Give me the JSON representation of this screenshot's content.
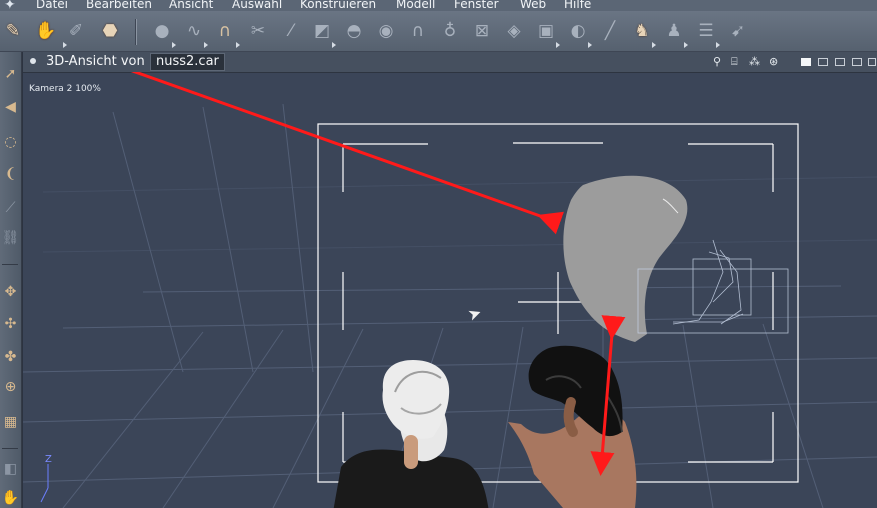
{
  "app": {
    "menu": [
      "Datei",
      "Bearbeiten",
      "Ansicht",
      "Auswahl",
      "Konstruieren",
      "Modell",
      "Fenster",
      "Web",
      "Hilfe"
    ]
  },
  "toolbar": {
    "tools": [
      {
        "icon": "brush-tool-icon"
      },
      {
        "icon": "hand-tool-icon"
      },
      {
        "icon": "bone-tool-icon"
      },
      {
        "icon": "paint-bucket-icon"
      },
      {
        "icon": "sphere-icon"
      },
      {
        "icon": "spline-icon"
      },
      {
        "icon": "magnet-icon"
      },
      {
        "icon": "scissors-icon"
      },
      {
        "icon": "line-icon"
      },
      {
        "icon": "box-icon"
      },
      {
        "icon": "hemisphere-icon"
      },
      {
        "icon": "lathe-icon"
      },
      {
        "icon": "arch-icon"
      },
      {
        "icon": "goblet-icon"
      },
      {
        "icon": "crossbox-icon"
      },
      {
        "icon": "plane-icon"
      },
      {
        "icon": "bag-icon"
      },
      {
        "icon": "scatter-icon"
      },
      {
        "icon": "pen-icon"
      },
      {
        "icon": "puppet-icon"
      },
      {
        "icon": "shadow-puppet-icon"
      },
      {
        "icon": "stack-icon"
      },
      {
        "icon": "pointer-icon"
      }
    ]
  },
  "sidebar": {
    "tools": [
      {
        "icon": "arrow-icon"
      },
      {
        "icon": "cone-icon"
      },
      {
        "icon": "ring-icon"
      },
      {
        "icon": "coil-icon"
      },
      {
        "icon": "needle-icon"
      },
      {
        "icon": "chain-icon"
      },
      {
        "icon": "move-icon"
      },
      {
        "icon": "scale-icon"
      },
      {
        "icon": "rotate-icon"
      },
      {
        "icon": "orbit-icon"
      },
      {
        "icon": "texture-icon"
      },
      {
        "icon": "camera-icon"
      },
      {
        "icon": "hand-icon"
      }
    ]
  },
  "viewport": {
    "title": "3D-Ansicht von",
    "filename": "nuss2.car",
    "camera_label": "Kamera 2 100%",
    "axis_label": "Z"
  }
}
